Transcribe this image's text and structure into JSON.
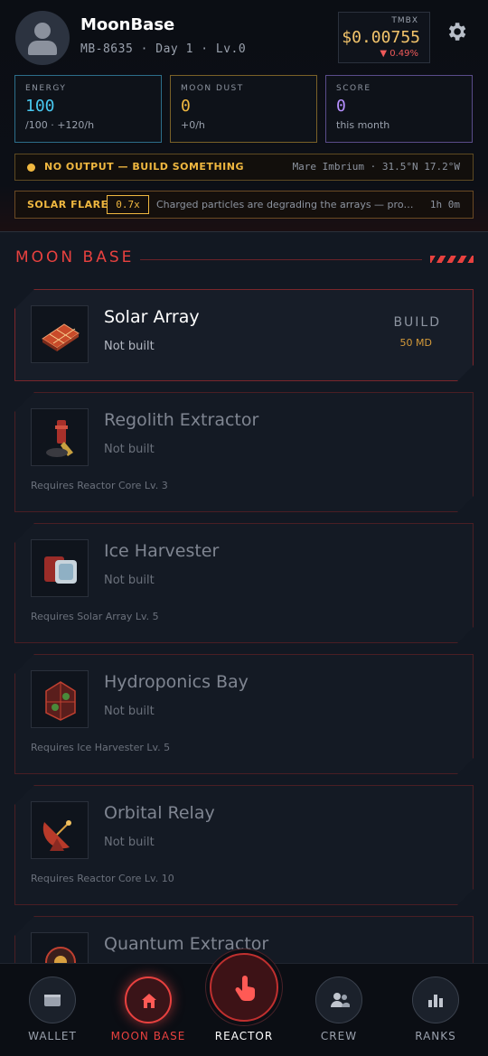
{
  "profile": {
    "name": "MoonBase",
    "meta": "MB-8635 · Day 1 · Lv.0"
  },
  "ticker": {
    "symbol": "TMBX",
    "price": "$0.00755",
    "change": "▼ 0.49%"
  },
  "stats": {
    "energy": {
      "label": "ENERGY",
      "value": "100",
      "sub": "/100 · +120/h"
    },
    "dust": {
      "label": "MOON DUST",
      "value": "0",
      "sub": "+0/h"
    },
    "score": {
      "label": "SCORE",
      "value": "0",
      "sub": "this month"
    }
  },
  "status": {
    "text": "NO OUTPUT — BUILD SOMETHING",
    "location": "Mare Imbrium · 31.5°N 17.2°W"
  },
  "flare": {
    "title": "SOLAR FLARE",
    "multiplier": "0.7x",
    "description": "Charged particles are degrading the arrays — productivity reduced",
    "timer": "1h 0m"
  },
  "section": {
    "title": "MOON BASE"
  },
  "buildings": [
    {
      "name": "Solar Array",
      "state": "Not built",
      "action": "BUILD",
      "cost": "50 MD",
      "icon": "solar-array-icon"
    },
    {
      "name": "Regolith Extractor",
      "state": "Not built",
      "requirement": "Requires Reactor Core Lv. 3",
      "icon": "extractor-icon"
    },
    {
      "name": "Ice Harvester",
      "state": "Not built",
      "requirement": "Requires Solar Array Lv. 5",
      "icon": "ice-harvester-icon"
    },
    {
      "name": "Hydroponics Bay",
      "state": "Not built",
      "requirement": "Requires Ice Harvester Lv. 5",
      "icon": "hydroponics-icon"
    },
    {
      "name": "Orbital Relay",
      "state": "Not built",
      "requirement": "Requires Reactor Core Lv. 10",
      "icon": "satellite-dish-icon"
    },
    {
      "name": "Quantum Extractor",
      "icon": "quantum-extractor-icon"
    }
  ],
  "nav": {
    "wallet": "WALLET",
    "moonbase": "MOON BASE",
    "reactor": "REACTOR",
    "crew": "CREW",
    "ranks": "RANKS"
  },
  "colors": {
    "accent": "#e8413f",
    "energy": "#48c8f0",
    "dust": "#f0b840",
    "score": "#b690ff",
    "price": "#f3c46b"
  }
}
